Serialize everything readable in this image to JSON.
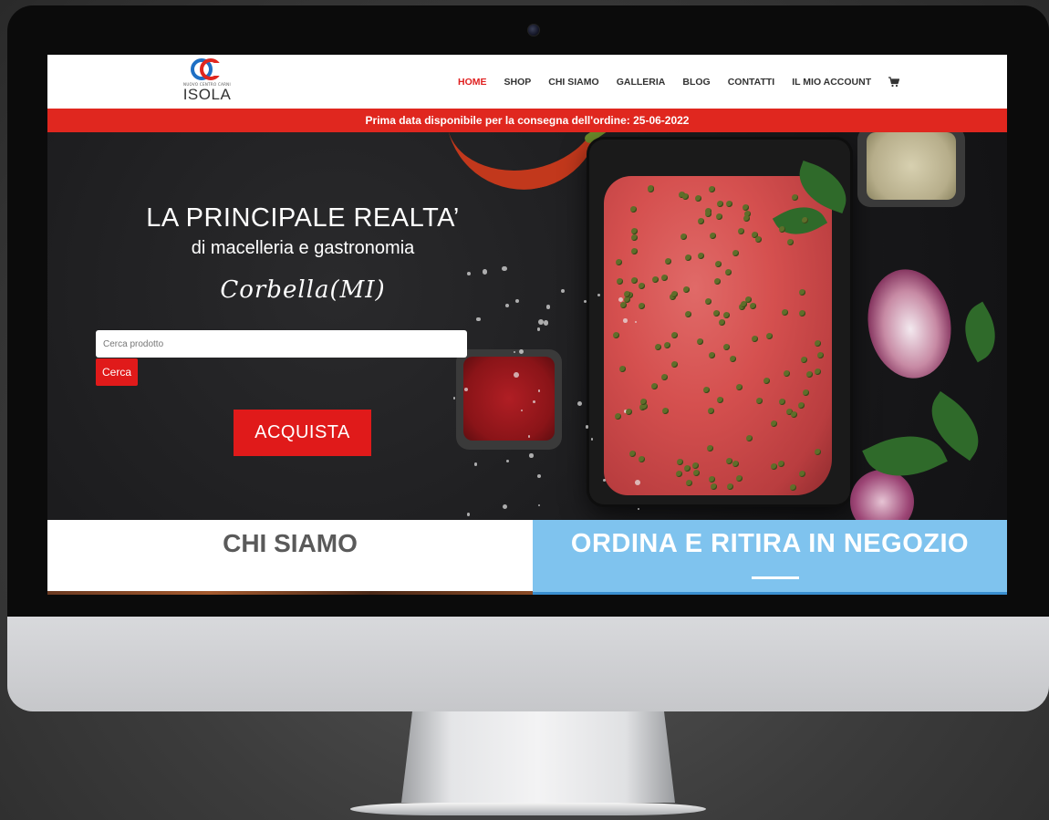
{
  "logo": {
    "tagline": "NUOVO CENTRO CARNI",
    "name": "ISOLA"
  },
  "nav": {
    "items": [
      {
        "label": "HOME",
        "active": true
      },
      {
        "label": "SHOP"
      },
      {
        "label": "CHI SIAMO"
      },
      {
        "label": "GALLERIA"
      },
      {
        "label": "BLOG"
      },
      {
        "label": "CONTATTI"
      },
      {
        "label": "IL MIO ACCOUNT"
      }
    ],
    "cart_icon": "cart-icon"
  },
  "banner": {
    "text": "Prima data disponibile per la consegna dell'ordine: 25-06-2022"
  },
  "hero": {
    "title": "LA PRINCIPALE REALTA’",
    "subtitle": "di macelleria e gastronomia",
    "location": "Corbella(MI)",
    "search": {
      "placeholder": "Cerca prodotto",
      "button_label": "Cerca"
    },
    "cta_label": "ACQUISTA"
  },
  "sections": {
    "left_title": "CHI SIAMO",
    "right_title": "ORDINA E RITIRA IN NEGOZIO"
  },
  "colors": {
    "accent_red": "#e0271f",
    "section_blue": "#7fc3ee"
  }
}
